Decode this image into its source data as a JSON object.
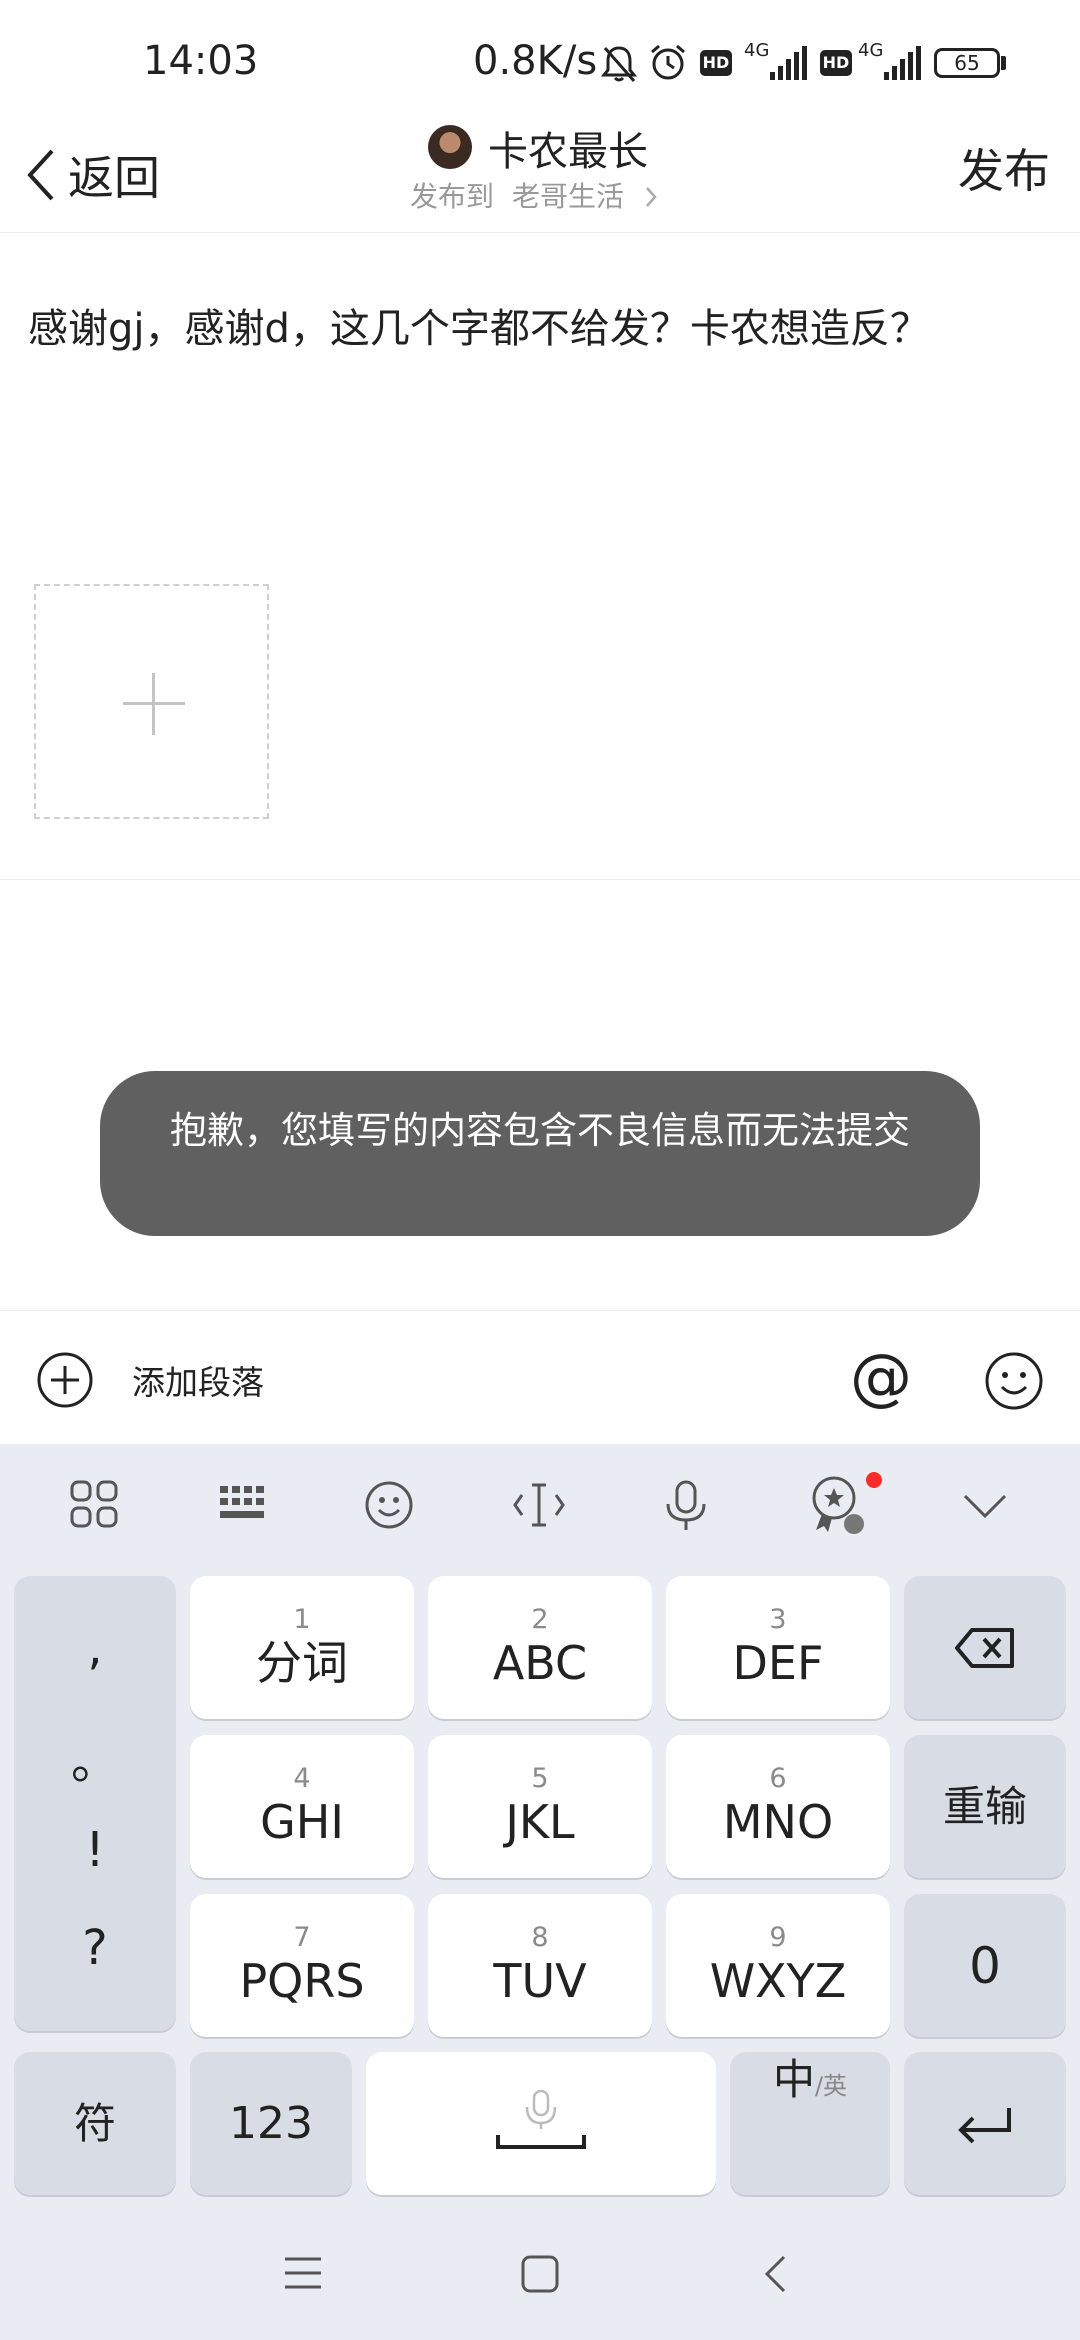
{
  "status_bar": {
    "time": "14:03",
    "net_speed": "0.8K/s",
    "hd1": "HD",
    "net1": "4G",
    "hd2": "HD",
    "net2": "4G",
    "battery": "65"
  },
  "header": {
    "back_label": "返回",
    "author": "卡农最长",
    "destination_prefix": "发布到",
    "destination": "老哥生活",
    "publish_label": "发布"
  },
  "post": {
    "text": "感谢gj，感谢d，这几个字都不给发？卡农想造反？"
  },
  "toast": {
    "message": "抱歉，您填写的内容包含不良信息而无法提交"
  },
  "editor_toolbar": {
    "add_paragraph": "添加段落",
    "at": "@"
  },
  "keyboard": {
    "punctuation": [
      ",",
      "。",
      "!",
      "?"
    ],
    "keys": [
      {
        "num": "1",
        "label": "分词"
      },
      {
        "num": "2",
        "label": "ABC"
      },
      {
        "num": "3",
        "label": "DEF"
      },
      {
        "num": "4",
        "label": "GHI"
      },
      {
        "num": "5",
        "label": "JKL"
      },
      {
        "num": "6",
        "label": "MNO"
      },
      {
        "num": "7",
        "label": "PQRS"
      },
      {
        "num": "8",
        "label": "TUV"
      },
      {
        "num": "9",
        "label": "WXYZ"
      }
    ],
    "reenter": "重输",
    "zero": "0",
    "symbols": "符",
    "numbers": "123",
    "lang_main": "中",
    "lang_alt": "/英"
  },
  "colors": {
    "toast_bg": "#606060",
    "keyboard_bg": "#e9ecf3",
    "badge": "#ff2a2a"
  }
}
